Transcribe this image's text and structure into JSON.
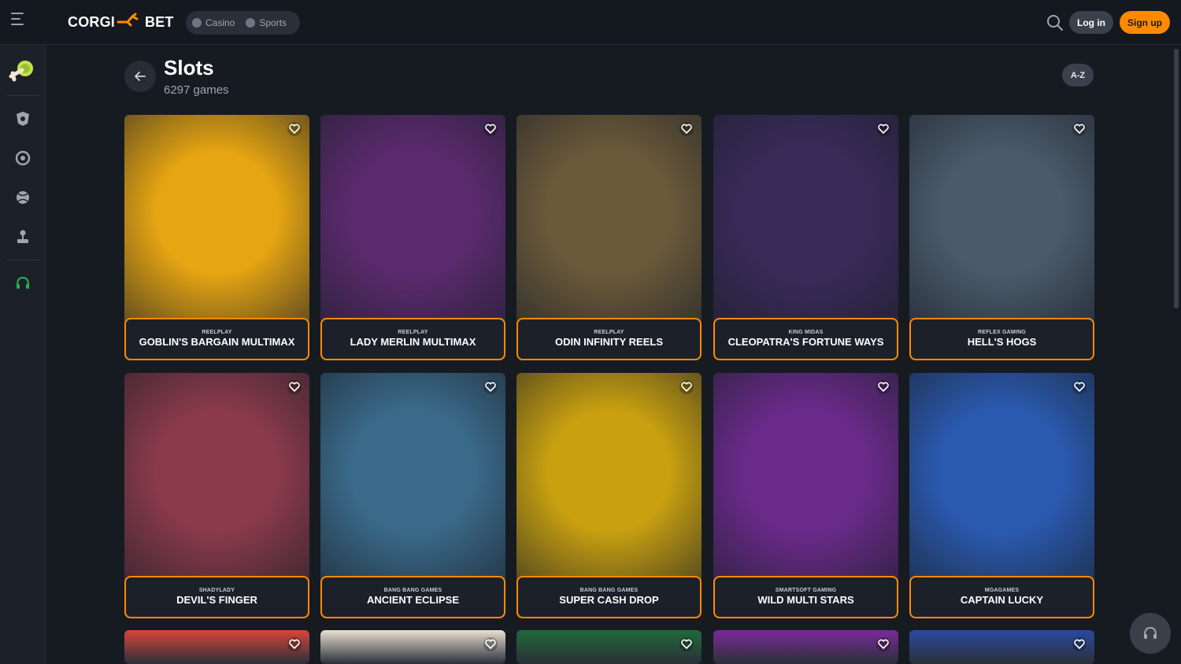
{
  "brand": {
    "logo_left": "CORGI",
    "logo_right": "BET",
    "accent": "#ff8a00"
  },
  "header": {
    "nav": [
      {
        "label": "Casino",
        "icon": "casino-chip-icon"
      },
      {
        "label": "Sports",
        "icon": "sports-ball-icon"
      }
    ],
    "login_label": "Log in",
    "signup_label": "Sign up"
  },
  "sidebar": {
    "items": [
      {
        "icon": "corgi-mascot-icon"
      },
      {
        "icon": "casino-chip-icon"
      },
      {
        "icon": "roulette-icon"
      },
      {
        "icon": "sports-ball-icon"
      },
      {
        "icon": "joystick-icon"
      },
      {
        "icon": "headset-icon"
      }
    ]
  },
  "page": {
    "title": "Slots",
    "count": "6297 games",
    "sort_label": "A-Z"
  },
  "games": [
    {
      "provider": "REELPLAY",
      "name": "GOBLIN'S BARGAIN MULTIMAX",
      "color": "#e6a512"
    },
    {
      "provider": "REELPLAY",
      "name": "LADY MERLIN MULTIMAX",
      "color": "#5b2a6e"
    },
    {
      "provider": "REELPLAY",
      "name": "ODIN INFINITY REELS",
      "color": "#6b5a3a"
    },
    {
      "provider": "KING MIDAS",
      "name": "CLEOPATRA'S FORTUNE WAYS",
      "color": "#3a2a5a"
    },
    {
      "provider": "REFLEX GAMING",
      "name": "HELL'S HOGS",
      "color": "#4a5a6a"
    },
    {
      "provider": "SHADYLADY",
      "name": "DEVIL'S FINGER",
      "color": "#8a3a4a"
    },
    {
      "provider": "BANG BANG GAMES",
      "name": "ANCIENT ECLIPSE",
      "color": "#3a6a8a"
    },
    {
      "provider": "BANG BANG GAMES",
      "name": "SUPER CASH DROP",
      "color": "#c8a010"
    },
    {
      "provider": "SMARTSOFT GAMING",
      "name": "WILD MULTI STARS",
      "color": "#6a2a8a"
    },
    {
      "provider": "MGAGAMES",
      "name": "CAPTAIN LUCKY",
      "color": "#2a5ab0"
    }
  ],
  "partial_row_colors": [
    "#d9453a",
    "#e8e0d0",
    "#1f6a3a",
    "#7a2a9a",
    "#2a4aa0"
  ]
}
